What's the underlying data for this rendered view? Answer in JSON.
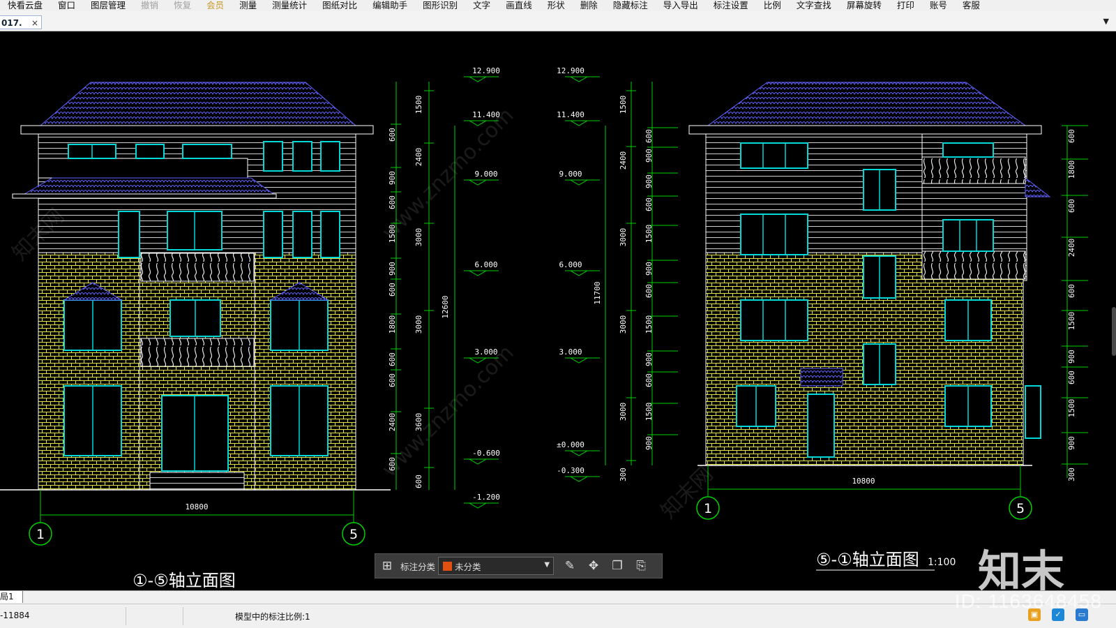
{
  "toolbar": {
    "items": [
      "快看云盘",
      "窗口",
      "图层管理",
      "撤销",
      "恢复",
      "会员",
      "测量",
      "测量统计",
      "图纸对比",
      "编辑助手",
      "图形识别",
      "文字",
      "画直线",
      "形状",
      "删除",
      "隐藏标注",
      "导入导出",
      "标注设置",
      "比例",
      "文字查找",
      "屏幕旋转",
      "打印",
      "账号",
      "客服"
    ],
    "disabled": [
      "撤销",
      "恢复"
    ],
    "highlight": [
      "会员"
    ]
  },
  "document_tab": {
    "label": "017.",
    "close": "×"
  },
  "drawing": {
    "left_scale_bar_right": [
      "12.900",
      "11.400",
      "9.000",
      "6.000",
      "3.000",
      "-0.600",
      "-1.200"
    ],
    "right_scale_bar_left": [
      "12.900",
      "11.400",
      "9.000",
      "6.000",
      "3.000",
      "±0.000",
      "-0.300"
    ],
    "left_vertical_dims": {
      "c1": [
        "600",
        "900",
        "600",
        "1500",
        "900",
        "600",
        "1800",
        "600",
        "600",
        "2400",
        "600"
      ],
      "c2": [
        "1500",
        "2400",
        "3000",
        "3000",
        "3600",
        "600"
      ],
      "total": "12600"
    },
    "right_vertical_dims": {
      "c1": [
        "1500",
        "2400",
        "3000",
        "3000",
        "3000",
        "300"
      ],
      "c2": [
        "600",
        "900",
        "900",
        "600",
        "1500",
        "900",
        "600",
        "1500",
        "900",
        "600",
        "1500",
        "900"
      ],
      "total": "11700"
    },
    "far_right_dims": [
      "600",
      "1800",
      "600",
      "2400",
      "600",
      "1500",
      "900",
      "600",
      "1500",
      "900",
      "300"
    ],
    "left_width": "10800",
    "right_width": "10800",
    "axis_bubbles": [
      "1",
      "5",
      "1",
      "5"
    ],
    "right_title": "⑤-①轴立面图",
    "right_title_scale": "1:100",
    "left_title_partial": "①-⑤轴立面图"
  },
  "annotation_bar": {
    "label": "标注分类",
    "select_value": "未分类"
  },
  "layout_tabs": {
    "label": "局1"
  },
  "statusbar": {
    "coords": "-11884",
    "scale_note": "模型中的标注比例:1"
  },
  "watermark": {
    "logo": "知末",
    "id": "ID: 1163648458",
    "site": "www.znzmo.com",
    "brand": "知末网"
  },
  "colors": {
    "cyan": "#00d8d8",
    "yellow": "#e0e040",
    "green": "#00d000",
    "blue": "#5050ff",
    "white": "#ffffff"
  }
}
